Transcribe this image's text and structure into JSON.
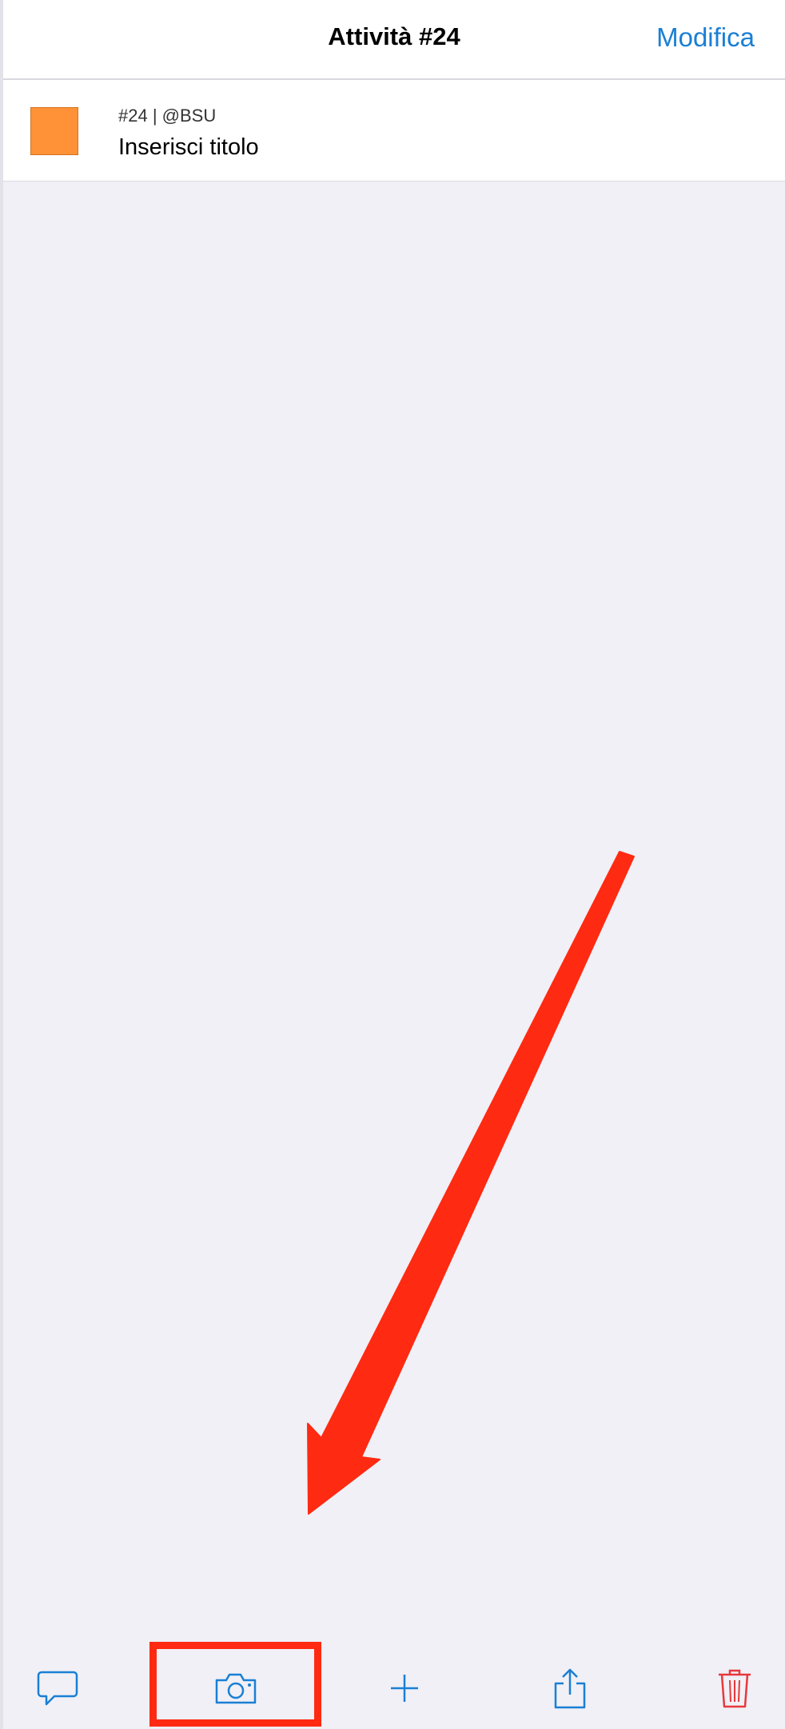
{
  "nav": {
    "title": "Attività #24",
    "edit_label": "Modifica"
  },
  "task": {
    "meta": "#24 | @BSU",
    "title": "Inserisci titolo",
    "color": "#ff9136"
  },
  "toolbar": {
    "items": [
      {
        "icon": "comment-icon",
        "color": "#1a7fd4"
      },
      {
        "icon": "camera-icon",
        "color": "#1a7fd4"
      },
      {
        "icon": "plus-icon",
        "color": "#1a7fd4"
      },
      {
        "icon": "share-icon",
        "color": "#1a7fd4"
      },
      {
        "icon": "trash-icon",
        "color": "#e8383b"
      }
    ]
  },
  "annotation": {
    "color": "#ff2a12"
  }
}
